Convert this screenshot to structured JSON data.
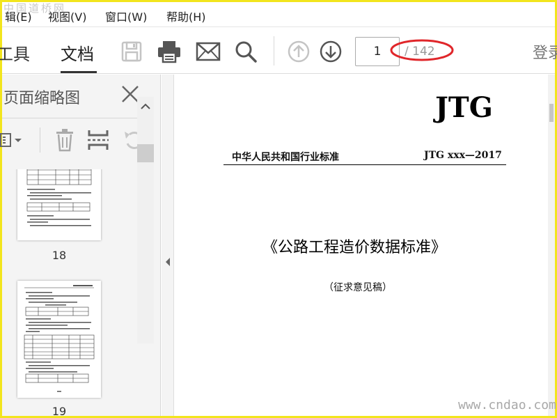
{
  "menu": {
    "items": [
      {
        "label": "辑(E)"
      },
      {
        "label": "视图(V)"
      },
      {
        "label": "窗口(W)"
      },
      {
        "label": "帮助(H)"
      }
    ],
    "watermark": "中国道桥网"
  },
  "toolbar": {
    "tabs": [
      {
        "label": "工具"
      },
      {
        "label": "文档"
      }
    ],
    "icons": [
      "save-icon",
      "print-icon",
      "mail-icon",
      "search-icon",
      "page-up-icon",
      "page-down-icon"
    ],
    "page_current": "1",
    "page_total": "/ 142",
    "login_label": "登录",
    "highlight_color": "#e0262a"
  },
  "panel": {
    "title": "页面缩略图",
    "icons": [
      "options-menu-icon",
      "delete-icon",
      "crop-icon",
      "undo-icon"
    ],
    "thumbnails": [
      {
        "label": "18"
      },
      {
        "label": "19"
      }
    ]
  },
  "document": {
    "header_code_big": "JTG",
    "org": "中华人民共和国行业标准",
    "std_code": "JTG xxx—2017",
    "title": "《公路工程造价数据标准》",
    "subtitle": "（征求意见稿）"
  },
  "watermark_bottom": "www.cndao.com",
  "colors": {
    "accent": "#f2e51d",
    "icon_gray": "#8a8a8a",
    "icon_dark": "#555555",
    "disabled_icon": "#c4c4c4"
  }
}
